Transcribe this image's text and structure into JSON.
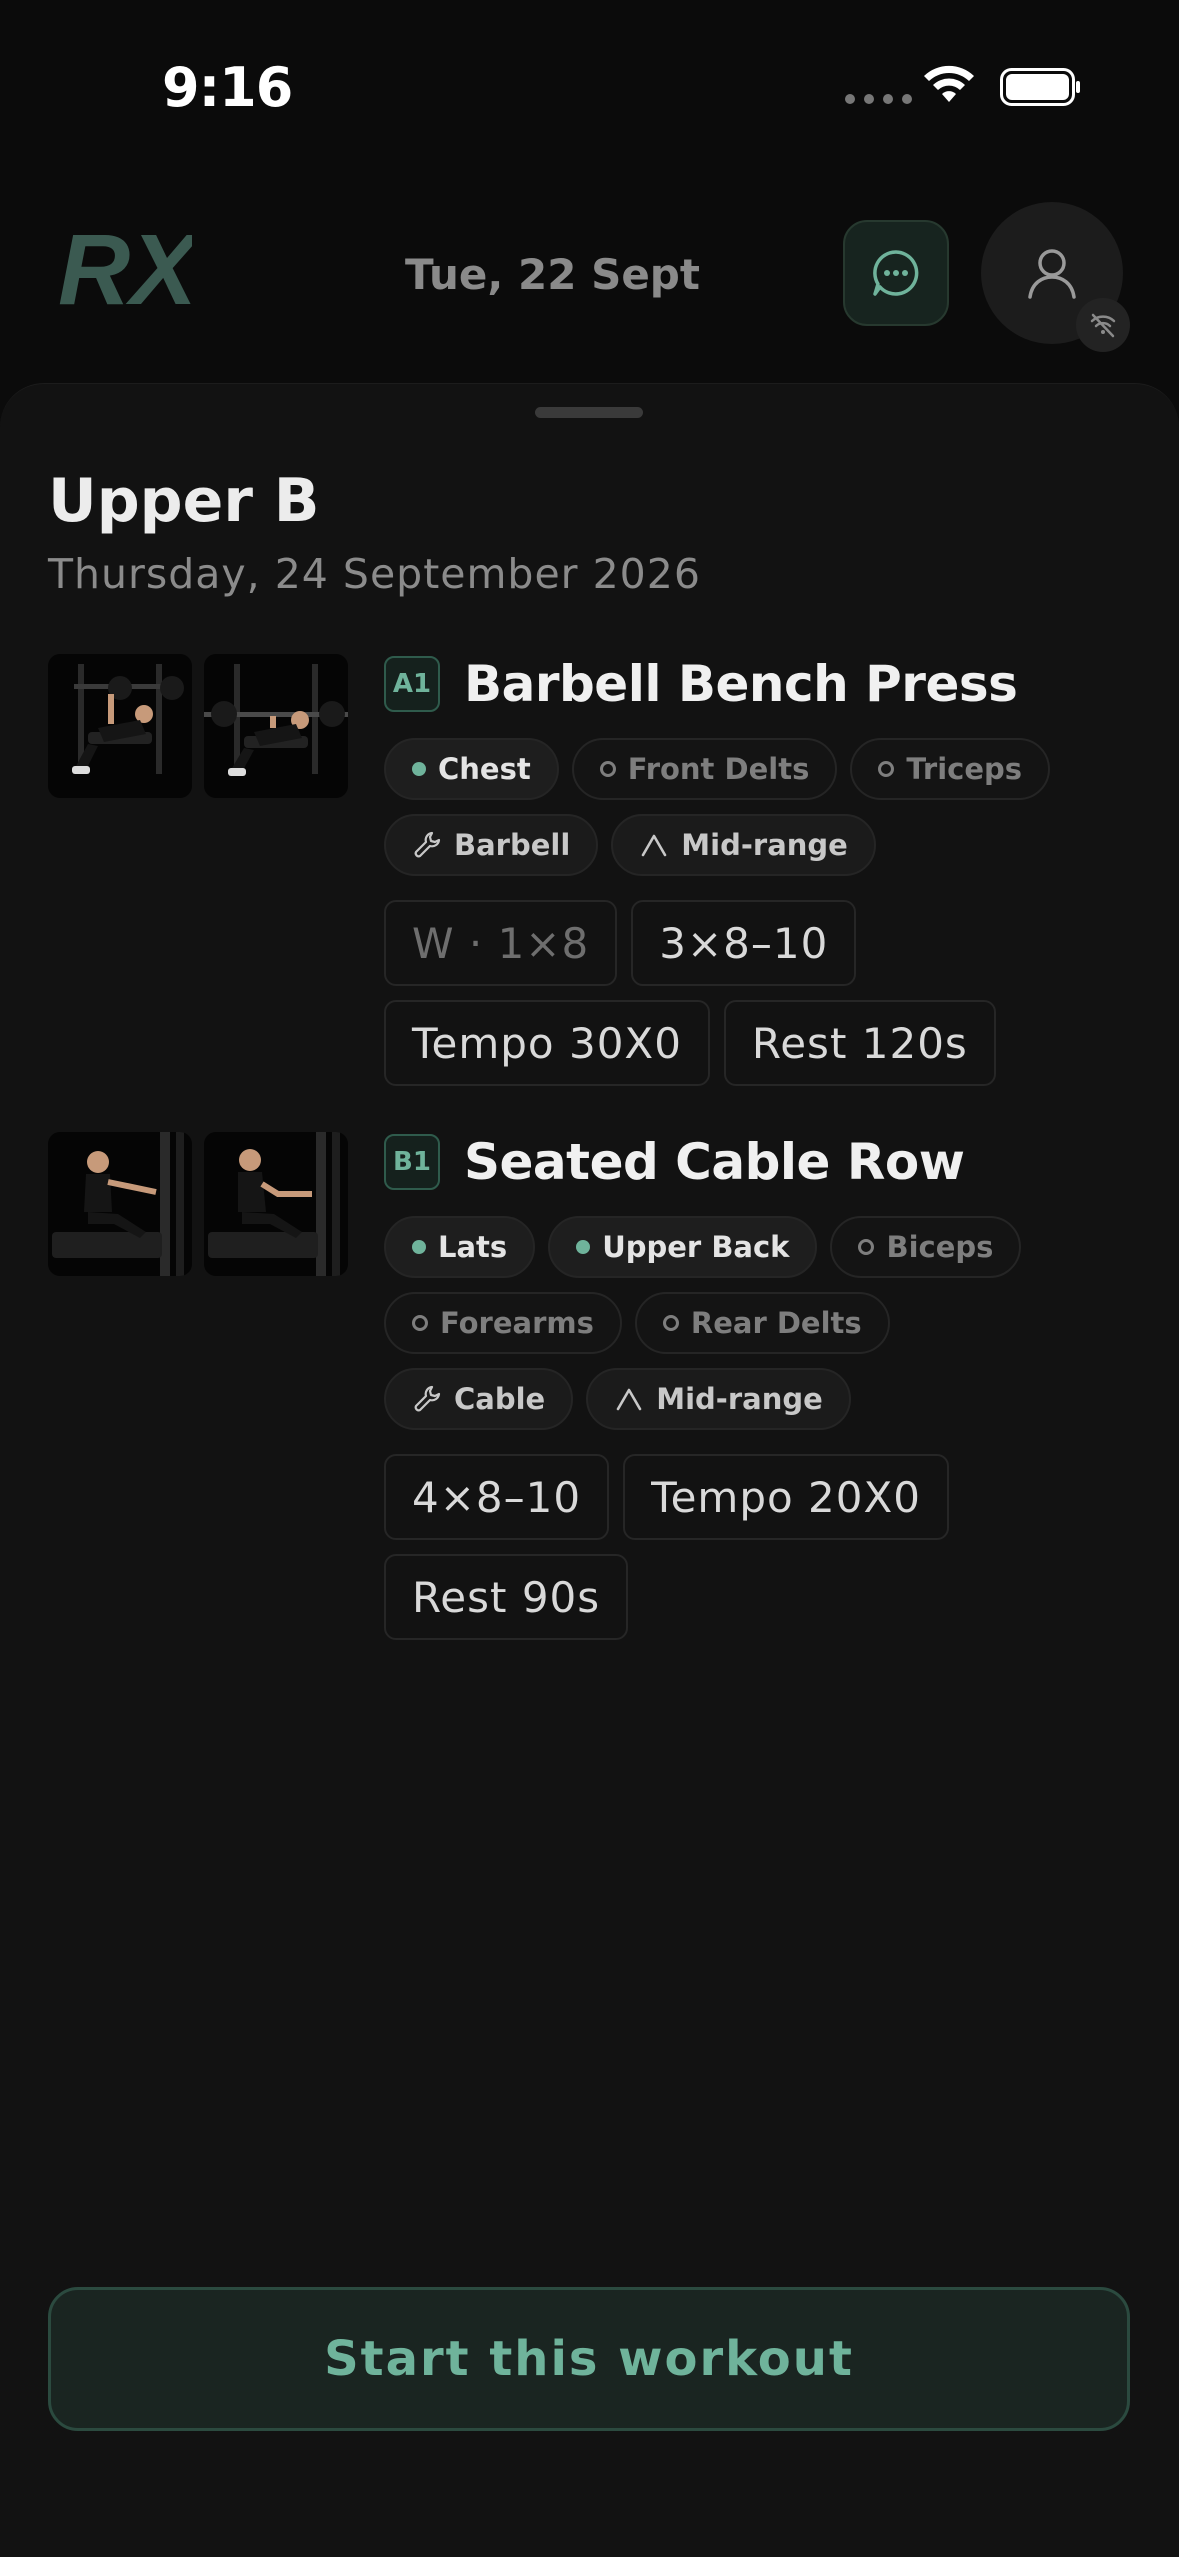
{
  "status_bar": {
    "time": "9:16"
  },
  "header": {
    "logo_text": "RX",
    "date": "Tue, 22 Sept",
    "icons": {
      "chat": "chat-bubble-icon",
      "profile": "person-icon",
      "offline": "wifi-off-icon"
    }
  },
  "workout": {
    "title": "Upper B",
    "date": "Thursday, 24 September 2026"
  },
  "exercises": [
    {
      "code": "A1",
      "name": "Barbell Bench Press",
      "muscles": [
        {
          "label": "Chest",
          "kind": "primary"
        },
        {
          "label": "Front Delts",
          "kind": "secondary"
        },
        {
          "label": "Triceps",
          "kind": "secondary"
        }
      ],
      "equipment": {
        "label": "Barbell",
        "icon": "wrench-icon"
      },
      "range": {
        "label": "Mid-range",
        "icon": "caret-up-icon"
      },
      "params": [
        "W · 1×8",
        "3×8–10",
        "Tempo 30X0",
        "Rest 120s"
      ]
    },
    {
      "code": "B1",
      "name": "Seated Cable Row",
      "muscles": [
        {
          "label": "Lats",
          "kind": "primary"
        },
        {
          "label": "Upper Back",
          "kind": "primary"
        },
        {
          "label": "Biceps",
          "kind": "secondary"
        },
        {
          "label": "Forearms",
          "kind": "secondary"
        },
        {
          "label": "Rear Delts",
          "kind": "secondary"
        }
      ],
      "equipment": {
        "label": "Cable",
        "icon": "wrench-icon"
      },
      "range": {
        "label": "Mid-range",
        "icon": "caret-up-icon"
      },
      "params": [
        "4×8–10",
        "Tempo 20X0",
        "Rest 90s"
      ]
    }
  ],
  "cta": {
    "label": "Start this workout"
  },
  "colors": {
    "accent": "#6fb39b",
    "background": "#0b0b0b",
    "sheet": "#121212"
  }
}
